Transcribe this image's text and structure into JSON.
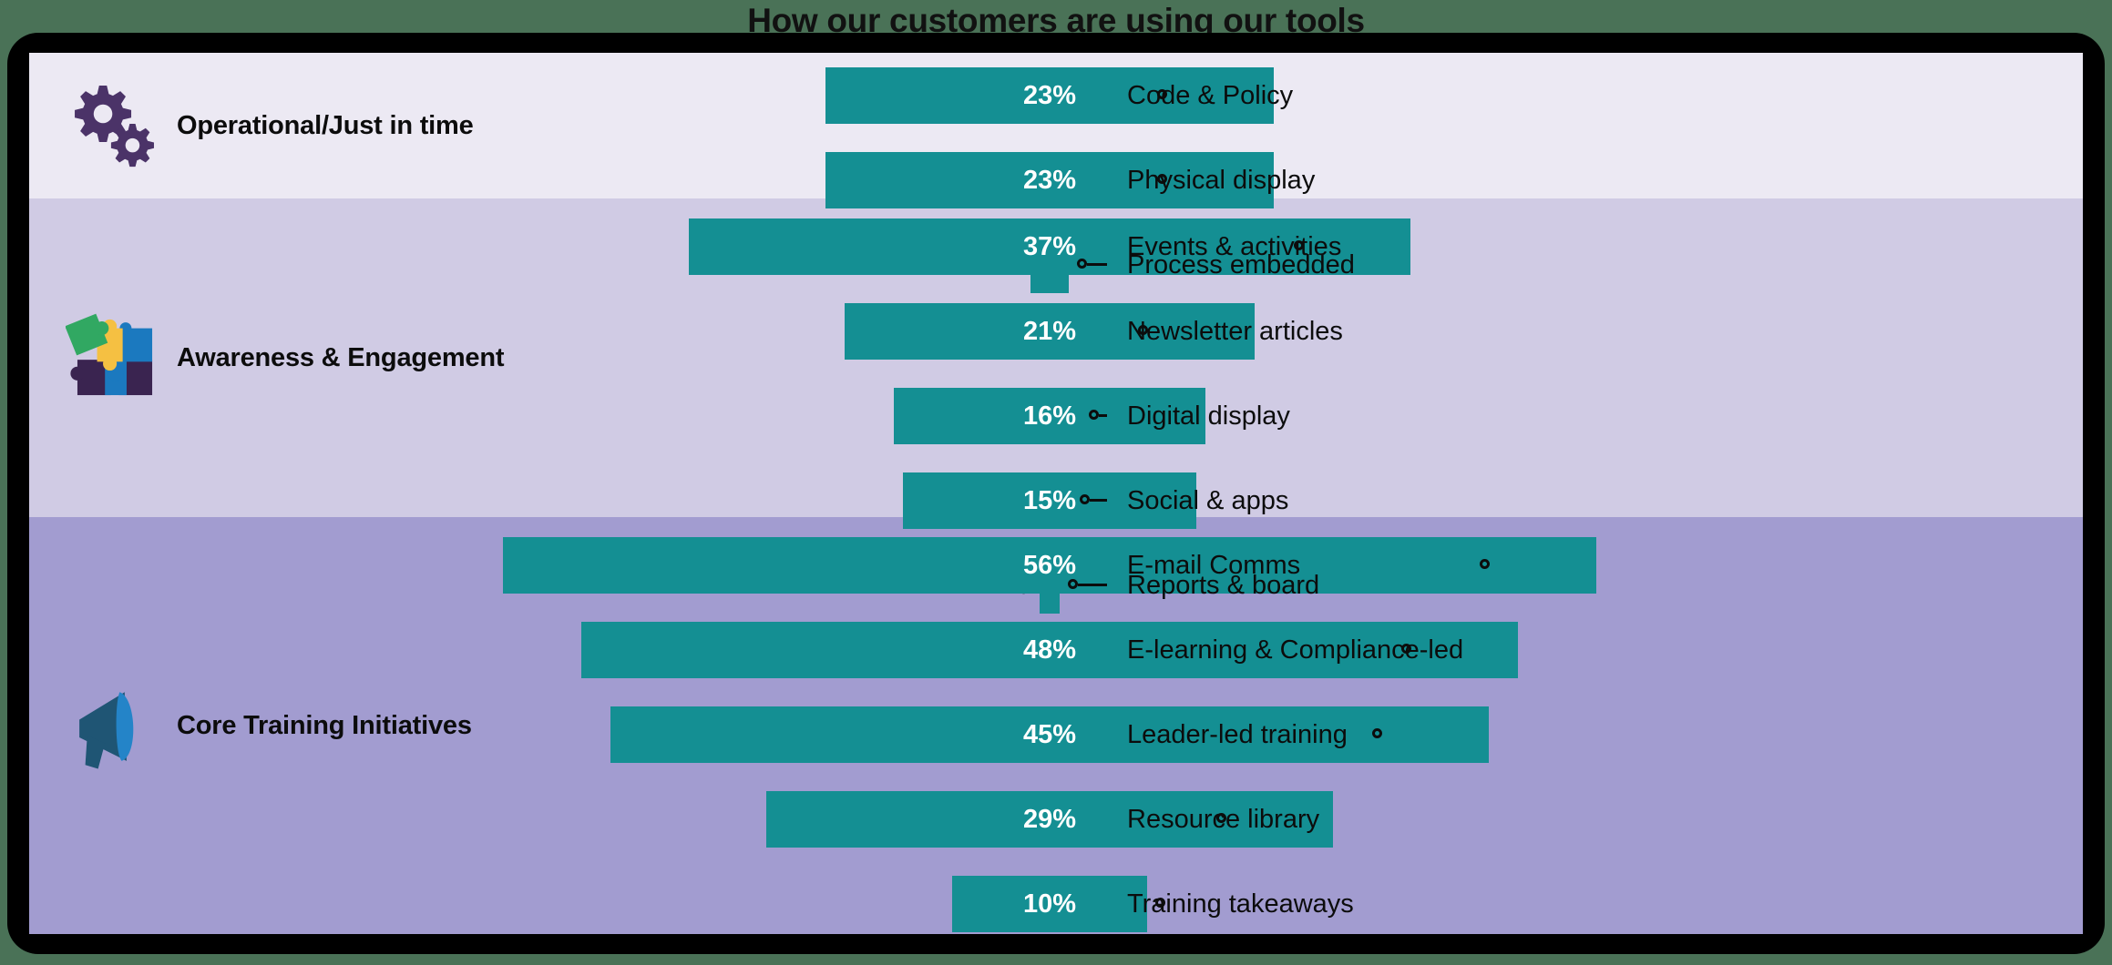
{
  "title": "How our customers are using our tools",
  "colors": {
    "bar": "#148f93",
    "frame": "#000000",
    "band_1": "#ece9f3",
    "band_2": "#d0cbe4",
    "band_3": "#a29cd0",
    "label_text": "#0c0c0c",
    "value_text_inside": "#ffffff",
    "leader": "#0c0c0c"
  },
  "chart_data": {
    "type": "bar",
    "subtype": "funnel",
    "title": "How our customers are using our tools",
    "xlabel": "",
    "ylabel": "",
    "value_unit": "%",
    "xlim": [
      0,
      56
    ],
    "grid": false,
    "legend": "none",
    "orientation": "horizontal-centered",
    "sections": [
      {
        "id": "operational",
        "name": "Operational/Just in time",
        "icon": "gears-icon",
        "background": "#ece9f3",
        "rows": [
          {
            "label": "Code & Policy",
            "value": 23,
            "value_text": "23%",
            "value_position": "inside"
          },
          {
            "label": "Physical display",
            "value": 23,
            "value_text": "23%",
            "value_position": "inside"
          },
          {
            "label": "Process embedded",
            "value": 2,
            "value_text": "2%",
            "value_position": "outside"
          }
        ]
      },
      {
        "id": "awareness",
        "name": "Awareness & Engagement",
        "icon": "puzzle-pieces-icon",
        "background": "#d0cbe4",
        "rows": [
          {
            "label": "Events & activities",
            "value": 37,
            "value_text": "37%",
            "value_position": "inside"
          },
          {
            "label": "Newsletter articles",
            "value": 21,
            "value_text": "21%",
            "value_position": "inside"
          },
          {
            "label": "Digital display",
            "value": 16,
            "value_text": "16%",
            "value_position": "inside"
          },
          {
            "label": "Social & apps",
            "value": 15,
            "value_text": "15%",
            "value_position": "inside"
          },
          {
            "label": "Reports & board",
            "value": 1,
            "value_text": "1%",
            "value_position": "outside"
          }
        ]
      },
      {
        "id": "core-training",
        "name": "Core Training Initiatives",
        "icon": "megaphone-icon",
        "background": "#a29cd0",
        "rows": [
          {
            "label": "E-mail Comms",
            "value": 56,
            "value_text": "56%",
            "value_position": "inside"
          },
          {
            "label": "E-learning & Compliance-led",
            "value": 48,
            "value_text": "48%",
            "value_position": "inside"
          },
          {
            "label": "Leader-led training",
            "value": 45,
            "value_text": "45%",
            "value_position": "inside"
          },
          {
            "label": "Resource library",
            "value": 29,
            "value_text": "29%",
            "value_position": "inside"
          },
          {
            "label": "Training takeaways",
            "value": 10,
            "value_text": "10%",
            "value_position": "inside"
          }
        ]
      }
    ]
  }
}
